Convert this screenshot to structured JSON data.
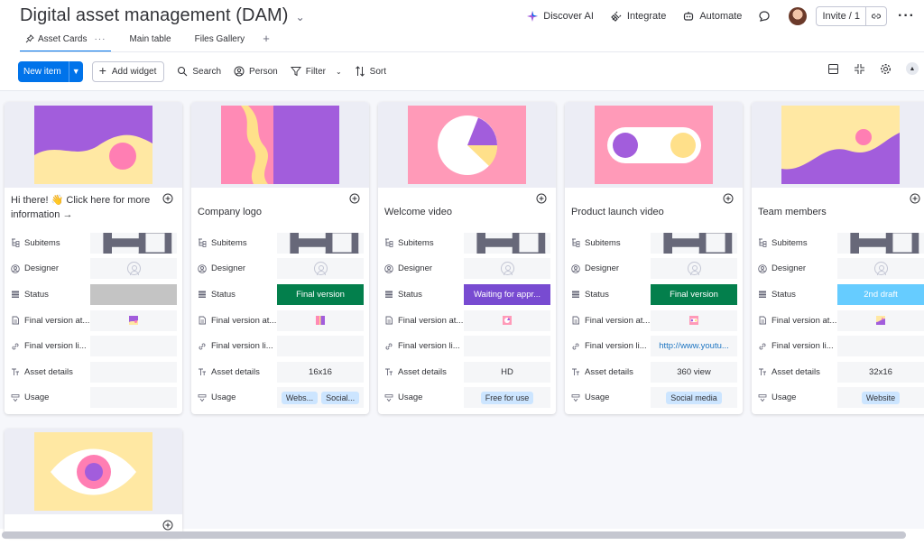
{
  "header": {
    "title": "Digital asset management (DAM)",
    "actions": {
      "discover": "Discover AI",
      "integrate": "Integrate",
      "automate": "Automate"
    },
    "invite": "Invite / 1"
  },
  "tabs": [
    {
      "label": "Asset Cards",
      "active": true
    },
    {
      "label": "Main table",
      "active": false
    },
    {
      "label": "Files Gallery",
      "active": false
    }
  ],
  "toolbar": {
    "new_item": "New item",
    "add_widget": "Add widget",
    "search": "Search",
    "person": "Person",
    "filter": "Filter",
    "sort": "Sort"
  },
  "field_labels": {
    "subitems": "Subitems",
    "designer": "Designer",
    "status": "Status",
    "final_version_at": "Final version at...",
    "final_version_link": "Final version li...",
    "asset_details": "Asset details",
    "usage": "Usage"
  },
  "colors": {
    "accent": "#0073ea",
    "status_final": "#037f4c",
    "status_waiting": "#784bd1",
    "status_draft": "#66ccff",
    "status_empty": "#c4c4c4"
  },
  "cards": [
    {
      "title": "Hi there! 👋 Click here for more information →",
      "status": "",
      "status_color": "#c4c4c4",
      "link": "",
      "details": "",
      "usage": []
    },
    {
      "title": "Company logo",
      "status": "Final version",
      "status_color": "#037f4c",
      "link": "",
      "details": "16x16",
      "usage": [
        "Webs...",
        "Social..."
      ]
    },
    {
      "title": "Welcome video",
      "status": "Waiting for appr...",
      "status_color": "#784bd1",
      "link": "",
      "details": "HD",
      "usage": [
        "Free for use"
      ]
    },
    {
      "title": "Product launch video",
      "status": "Final version",
      "status_color": "#037f4c",
      "link": "http://www.youtu...",
      "details": "360 view",
      "usage": [
        "Social media"
      ]
    },
    {
      "title": "Team members",
      "status": "2nd draft",
      "status_color": "#66ccff",
      "link": "",
      "details": "32x16",
      "usage": [
        "Website"
      ]
    }
  ]
}
